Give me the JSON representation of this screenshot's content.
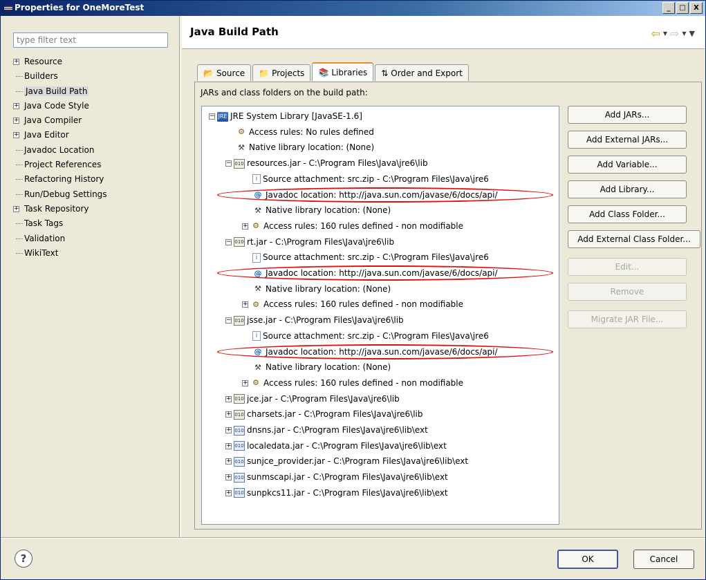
{
  "window": {
    "title": "Properties for OneMoreTest",
    "minimize": "_",
    "maximize": "□",
    "close": "X"
  },
  "filter": {
    "placeholder": "type filter text",
    "value": ""
  },
  "nav": {
    "items": [
      {
        "label": "Resource",
        "expandable": true
      },
      {
        "label": "Builders",
        "expandable": false
      },
      {
        "label": "Java Build Path",
        "expandable": false,
        "selected": true
      },
      {
        "label": "Java Code Style",
        "expandable": true
      },
      {
        "label": "Java Compiler",
        "expandable": true
      },
      {
        "label": "Java Editor",
        "expandable": true
      },
      {
        "label": "Javadoc Location",
        "expandable": false
      },
      {
        "label": "Project References",
        "expandable": false
      },
      {
        "label": "Refactoring History",
        "expandable": false
      },
      {
        "label": "Run/Debug Settings",
        "expandable": false
      },
      {
        "label": "Task Repository",
        "expandable": true
      },
      {
        "label": "Task Tags",
        "expandable": false
      },
      {
        "label": "Validation",
        "expandable": false
      },
      {
        "label": "WikiText",
        "expandable": false
      }
    ]
  },
  "page": {
    "title": "Java Build Path",
    "tabs": {
      "source": "Source",
      "projects": "Projects",
      "libraries": "Libraries",
      "order": "Order and Export"
    },
    "caption": "JARs and class folders on the build path:"
  },
  "tree": {
    "rows": [
      {
        "level": 0,
        "exp": "−",
        "icon": "lib",
        "text": "JRE System Library [JavaSE-1.6]"
      },
      {
        "level": 1,
        "exp": "",
        "icon": "rules",
        "text": "Access rules: No rules defined"
      },
      {
        "level": 1,
        "exp": "",
        "icon": "native",
        "text": "Native library location: (None)"
      },
      {
        "level": 1,
        "exp": "−",
        "icon": "jar",
        "text": "resources.jar - C:\\Program Files\\Java\\jre6\\lib"
      },
      {
        "level": 2,
        "exp": "",
        "icon": "src",
        "text": "Source attachment: src.zip - C:\\Program Files\\Java\\jre6"
      },
      {
        "level": 2,
        "exp": "",
        "icon": "at",
        "text": "Javadoc location: http://java.sun.com/javase/6/docs/api/",
        "hl": true
      },
      {
        "level": 2,
        "exp": "",
        "icon": "native",
        "text": "Native library location: (None)"
      },
      {
        "level": 2,
        "exp": "+",
        "icon": "rules",
        "text": "Access rules: 160 rules defined - non modifiable"
      },
      {
        "level": 1,
        "exp": "−",
        "icon": "jar",
        "text": "rt.jar - C:\\Program Files\\Java\\jre6\\lib"
      },
      {
        "level": 2,
        "exp": "",
        "icon": "src",
        "text": "Source attachment: src.zip - C:\\Program Files\\Java\\jre6"
      },
      {
        "level": 2,
        "exp": "",
        "icon": "at",
        "text": "Javadoc location: http://java.sun.com/javase/6/docs/api/",
        "hl": true
      },
      {
        "level": 2,
        "exp": "",
        "icon": "native",
        "text": "Native library location: (None)"
      },
      {
        "level": 2,
        "exp": "+",
        "icon": "rules",
        "text": "Access rules: 160 rules defined - non modifiable"
      },
      {
        "level": 1,
        "exp": "−",
        "icon": "jar",
        "text": "jsse.jar - C:\\Program Files\\Java\\jre6\\lib"
      },
      {
        "level": 2,
        "exp": "",
        "icon": "src",
        "text": "Source attachment: src.zip - C:\\Program Files\\Java\\jre6"
      },
      {
        "level": 2,
        "exp": "",
        "icon": "at",
        "text": "Javadoc location: http://java.sun.com/javase/6/docs/api/",
        "hl": true
      },
      {
        "level": 2,
        "exp": "",
        "icon": "native",
        "text": "Native library location: (None)"
      },
      {
        "level": 2,
        "exp": "+",
        "icon": "rules",
        "text": "Access rules: 160 rules defined - non modifiable"
      },
      {
        "level": 1,
        "exp": "+",
        "icon": "jar",
        "text": "jce.jar - C:\\Program Files\\Java\\jre6\\lib"
      },
      {
        "level": 1,
        "exp": "+",
        "icon": "jar",
        "text": "charsets.jar - C:\\Program Files\\Java\\jre6\\lib"
      },
      {
        "level": 1,
        "exp": "+",
        "icon": "jar-b",
        "text": "dnsns.jar - C:\\Program Files\\Java\\jre6\\lib\\ext"
      },
      {
        "level": 1,
        "exp": "+",
        "icon": "jar-b",
        "text": "localedata.jar - C:\\Program Files\\Java\\jre6\\lib\\ext"
      },
      {
        "level": 1,
        "exp": "+",
        "icon": "jar-b",
        "text": "sunjce_provider.jar - C:\\Program Files\\Java\\jre6\\lib\\ext"
      },
      {
        "level": 1,
        "exp": "+",
        "icon": "jar-b",
        "text": "sunmscapi.jar - C:\\Program Files\\Java\\jre6\\lib\\ext"
      },
      {
        "level": 1,
        "exp": "+",
        "icon": "jar-b",
        "text": "sunpkcs11.jar - C:\\Program Files\\Java\\jre6\\lib\\ext"
      }
    ]
  },
  "buttons": {
    "add_jars": "Add JARs...",
    "add_external_jars": "Add External JARs...",
    "add_variable": "Add Variable...",
    "add_library": "Add Library...",
    "add_class_folder": "Add Class Folder...",
    "add_external_class_folder": "Add External Class Folder...",
    "edit": "Edit...",
    "remove": "Remove",
    "migrate_jar": "Migrate JAR File..."
  },
  "footer": {
    "help": "?",
    "ok": "OK",
    "cancel": "Cancel"
  },
  "colors": {
    "highlight": "#e01010",
    "titlebar": "#0a246a",
    "accent_tab": "#e68b2c"
  }
}
